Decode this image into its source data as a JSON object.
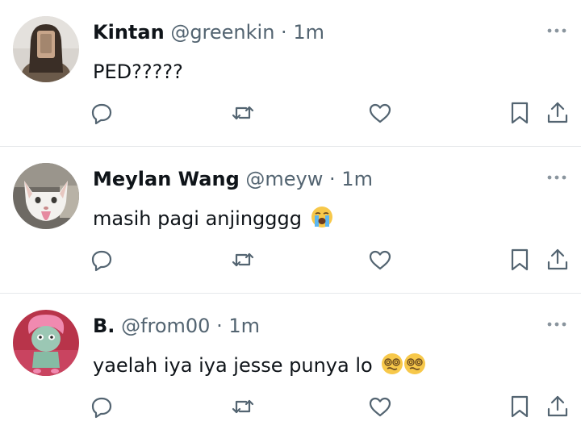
{
  "tweets": [
    {
      "name": "Kintan",
      "handle": "@greenkin",
      "separator": "·",
      "time": "1m",
      "text": "PED?????",
      "emojis": []
    },
    {
      "name": "Meylan Wang",
      "handle": "@meyw",
      "separator": "·",
      "time": "1m",
      "text": "masih pagi anjingggg",
      "emojis": [
        "loudly-crying-face"
      ]
    },
    {
      "name": "B.",
      "handle": "@from00",
      "separator": "·",
      "time": "1m",
      "text": "yaelah iya iya jesse punya lo",
      "emojis": [
        "dizzy-eyes-face",
        "dizzy-eyes-face"
      ]
    }
  ],
  "icons": {
    "more": "more-dots-icon",
    "reply": "reply-icon",
    "retweet": "retweet-icon",
    "like": "heart-icon",
    "bookmark": "bookmark-icon",
    "share": "share-icon"
  },
  "colors": {
    "text": "#0f1419",
    "muted": "#536471",
    "divider": "#e6e9eb"
  }
}
